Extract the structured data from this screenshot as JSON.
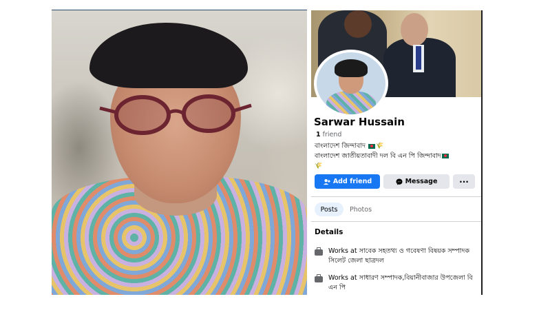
{
  "profile": {
    "name": "Sarwar Hussain",
    "friends_count": "1",
    "friends_label": "friend",
    "bio_line1": "বাংলাদেশ জিন্দাবাদ",
    "bio_line2": "বাংলাদেশ জাতীয়তাবাদী দল বি এন পি জিন্দাবাদ"
  },
  "actions": {
    "add_friend": "Add friend",
    "message": "Message",
    "more": "···"
  },
  "tabs": [
    {
      "label": "Posts",
      "active": true
    },
    {
      "label": "Photos",
      "active": false
    }
  ],
  "details": {
    "title": "Details",
    "items": [
      {
        "text": "Works at সাবেক সহতথ্য ও গবেষণা বিষয়ক সম্পাদক সিলেট জেলা ছাত্রদল",
        "icon": "briefcase-icon"
      },
      {
        "text": "Works at সাধারণ সম্পাদক,বিয়ানীবাজার উপজেলা বি এন পি",
        "icon": "briefcase-icon"
      }
    ]
  },
  "colors": {
    "primary_button": "#1877f2",
    "secondary_button": "#e4e6eb",
    "text": "#050505",
    "muted_text": "#65676b"
  }
}
